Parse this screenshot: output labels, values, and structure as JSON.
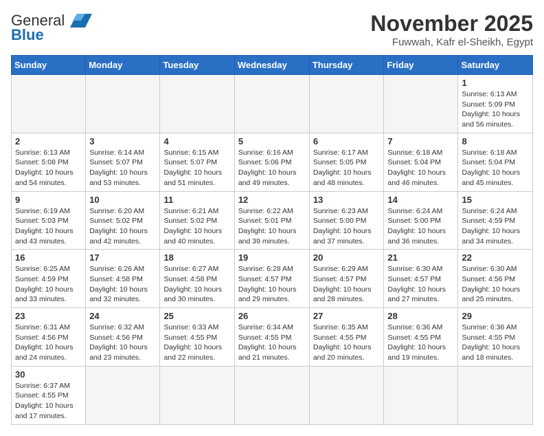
{
  "logo": {
    "general": "General",
    "blue": "Blue"
  },
  "header": {
    "month": "November 2025",
    "location": "Fuwwah, Kafr el-Sheikh, Egypt"
  },
  "weekdays": [
    "Sunday",
    "Monday",
    "Tuesday",
    "Wednesday",
    "Thursday",
    "Friday",
    "Saturday"
  ],
  "weeks": [
    [
      {
        "day": "",
        "info": ""
      },
      {
        "day": "",
        "info": ""
      },
      {
        "day": "",
        "info": ""
      },
      {
        "day": "",
        "info": ""
      },
      {
        "day": "",
        "info": ""
      },
      {
        "day": "",
        "info": ""
      },
      {
        "day": "1",
        "info": "Sunrise: 6:13 AM\nSunset: 5:09 PM\nDaylight: 10 hours and 56 minutes."
      }
    ],
    [
      {
        "day": "2",
        "info": "Sunrise: 6:13 AM\nSunset: 5:08 PM\nDaylight: 10 hours and 54 minutes."
      },
      {
        "day": "3",
        "info": "Sunrise: 6:14 AM\nSunset: 5:07 PM\nDaylight: 10 hours and 53 minutes."
      },
      {
        "day": "4",
        "info": "Sunrise: 6:15 AM\nSunset: 5:07 PM\nDaylight: 10 hours and 51 minutes."
      },
      {
        "day": "5",
        "info": "Sunrise: 6:16 AM\nSunset: 5:06 PM\nDaylight: 10 hours and 49 minutes."
      },
      {
        "day": "6",
        "info": "Sunrise: 6:17 AM\nSunset: 5:05 PM\nDaylight: 10 hours and 48 minutes."
      },
      {
        "day": "7",
        "info": "Sunrise: 6:18 AM\nSunset: 5:04 PM\nDaylight: 10 hours and 46 minutes."
      },
      {
        "day": "8",
        "info": "Sunrise: 6:18 AM\nSunset: 5:04 PM\nDaylight: 10 hours and 45 minutes."
      }
    ],
    [
      {
        "day": "9",
        "info": "Sunrise: 6:19 AM\nSunset: 5:03 PM\nDaylight: 10 hours and 43 minutes."
      },
      {
        "day": "10",
        "info": "Sunrise: 6:20 AM\nSunset: 5:02 PM\nDaylight: 10 hours and 42 minutes."
      },
      {
        "day": "11",
        "info": "Sunrise: 6:21 AM\nSunset: 5:02 PM\nDaylight: 10 hours and 40 minutes."
      },
      {
        "day": "12",
        "info": "Sunrise: 6:22 AM\nSunset: 5:01 PM\nDaylight: 10 hours and 39 minutes."
      },
      {
        "day": "13",
        "info": "Sunrise: 6:23 AM\nSunset: 5:00 PM\nDaylight: 10 hours and 37 minutes."
      },
      {
        "day": "14",
        "info": "Sunrise: 6:24 AM\nSunset: 5:00 PM\nDaylight: 10 hours and 36 minutes."
      },
      {
        "day": "15",
        "info": "Sunrise: 6:24 AM\nSunset: 4:59 PM\nDaylight: 10 hours and 34 minutes."
      }
    ],
    [
      {
        "day": "16",
        "info": "Sunrise: 6:25 AM\nSunset: 4:59 PM\nDaylight: 10 hours and 33 minutes."
      },
      {
        "day": "17",
        "info": "Sunrise: 6:26 AM\nSunset: 4:58 PM\nDaylight: 10 hours and 32 minutes."
      },
      {
        "day": "18",
        "info": "Sunrise: 6:27 AM\nSunset: 4:58 PM\nDaylight: 10 hours and 30 minutes."
      },
      {
        "day": "19",
        "info": "Sunrise: 6:28 AM\nSunset: 4:57 PM\nDaylight: 10 hours and 29 minutes."
      },
      {
        "day": "20",
        "info": "Sunrise: 6:29 AM\nSunset: 4:57 PM\nDaylight: 10 hours and 28 minutes."
      },
      {
        "day": "21",
        "info": "Sunrise: 6:30 AM\nSunset: 4:57 PM\nDaylight: 10 hours and 27 minutes."
      },
      {
        "day": "22",
        "info": "Sunrise: 6:30 AM\nSunset: 4:56 PM\nDaylight: 10 hours and 25 minutes."
      }
    ],
    [
      {
        "day": "23",
        "info": "Sunrise: 6:31 AM\nSunset: 4:56 PM\nDaylight: 10 hours and 24 minutes."
      },
      {
        "day": "24",
        "info": "Sunrise: 6:32 AM\nSunset: 4:56 PM\nDaylight: 10 hours and 23 minutes."
      },
      {
        "day": "25",
        "info": "Sunrise: 6:33 AM\nSunset: 4:55 PM\nDaylight: 10 hours and 22 minutes."
      },
      {
        "day": "26",
        "info": "Sunrise: 6:34 AM\nSunset: 4:55 PM\nDaylight: 10 hours and 21 minutes."
      },
      {
        "day": "27",
        "info": "Sunrise: 6:35 AM\nSunset: 4:55 PM\nDaylight: 10 hours and 20 minutes."
      },
      {
        "day": "28",
        "info": "Sunrise: 6:36 AM\nSunset: 4:55 PM\nDaylight: 10 hours and 19 minutes."
      },
      {
        "day": "29",
        "info": "Sunrise: 6:36 AM\nSunset: 4:55 PM\nDaylight: 10 hours and 18 minutes."
      }
    ],
    [
      {
        "day": "30",
        "info": "Sunrise: 6:37 AM\nSunset: 4:55 PM\nDaylight: 10 hours and 17 minutes."
      },
      {
        "day": "",
        "info": ""
      },
      {
        "day": "",
        "info": ""
      },
      {
        "day": "",
        "info": ""
      },
      {
        "day": "",
        "info": ""
      },
      {
        "day": "",
        "info": ""
      },
      {
        "day": "",
        "info": ""
      }
    ]
  ]
}
